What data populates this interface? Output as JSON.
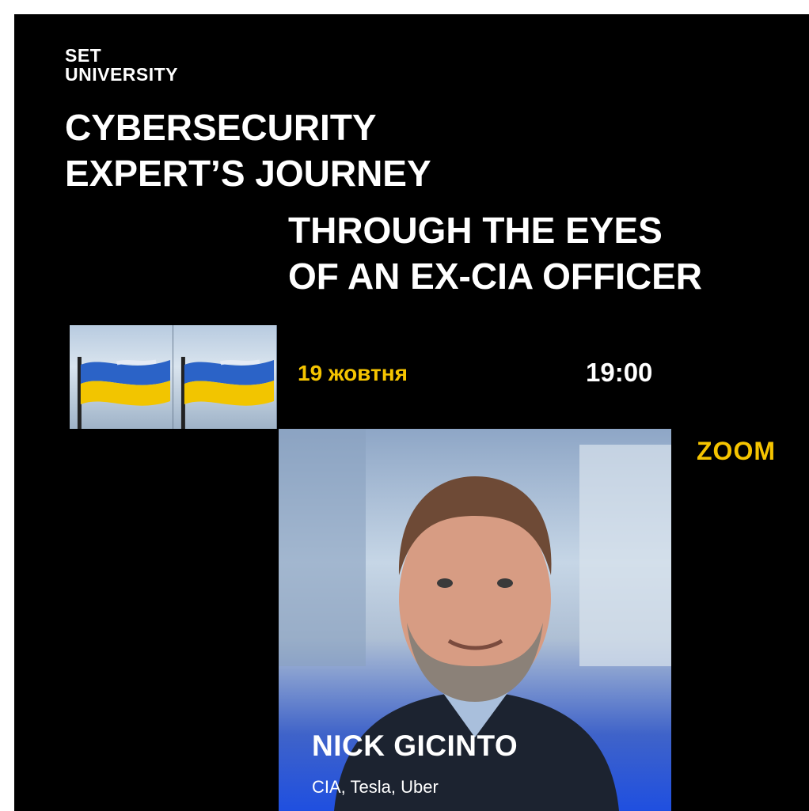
{
  "brand": {
    "line1": "SET",
    "line2": "UNIVERSITY"
  },
  "headline": {
    "line1": "CYBERSECURITY",
    "line2": "EXPERT’S JOURNEY",
    "line3": "THROUGH THE EYES",
    "line4": "OF AN EX-CIA OFFICER"
  },
  "event": {
    "date": "19 жовтня",
    "time": "19:00",
    "platform": "ZOOM"
  },
  "speaker": {
    "name": "NICK GICINTO",
    "affiliations": "CIA, Tesla, Uber"
  },
  "colors": {
    "background": "#000000",
    "accent": "#f5c400",
    "text": "#ffffff",
    "photo_blue": "#1f4fe0"
  }
}
